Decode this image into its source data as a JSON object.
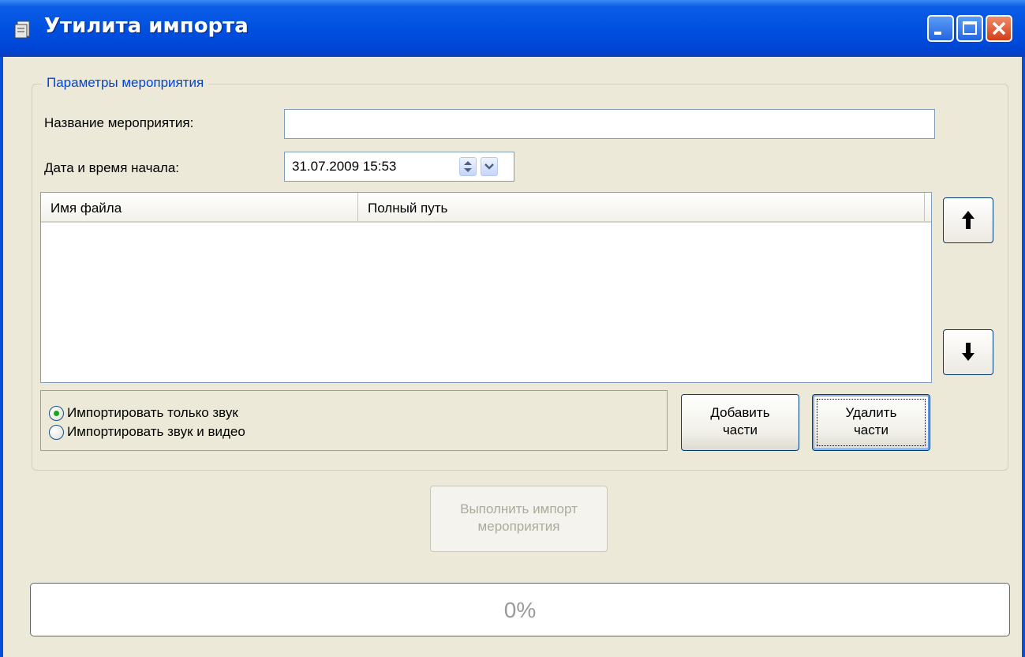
{
  "window": {
    "title": "Утилита импорта",
    "icon": "app-icon"
  },
  "group": {
    "legend": "Параметры мероприятия"
  },
  "form": {
    "event_name_label": "Название мероприятия:",
    "event_name_value": "",
    "start_label": "Дата и время начала:",
    "start_value": "31.07.2009 15:53"
  },
  "file_list": {
    "columns": [
      "Имя файла",
      "Полный путь"
    ],
    "rows": []
  },
  "import_mode": {
    "options": [
      "Импортировать только звук",
      "Импортировать звук и видео"
    ],
    "selected": "Импортировать только звук"
  },
  "buttons": {
    "add_line1": "Добавить",
    "add_line2": "части",
    "remove_line1": "Удалить",
    "remove_line2": "части",
    "run_line1": "Выполнить импорт",
    "run_line2": "мероприятия",
    "move_up_icon": "arrow-up-icon",
    "move_down_icon": "arrow-down-icon"
  },
  "progress": {
    "value": 0,
    "text": "0%"
  },
  "colors": {
    "titlebar": "#0050e0",
    "client_bg": "#ece9d8",
    "legend_text": "#0046d5",
    "close_button": "#d43e17"
  }
}
